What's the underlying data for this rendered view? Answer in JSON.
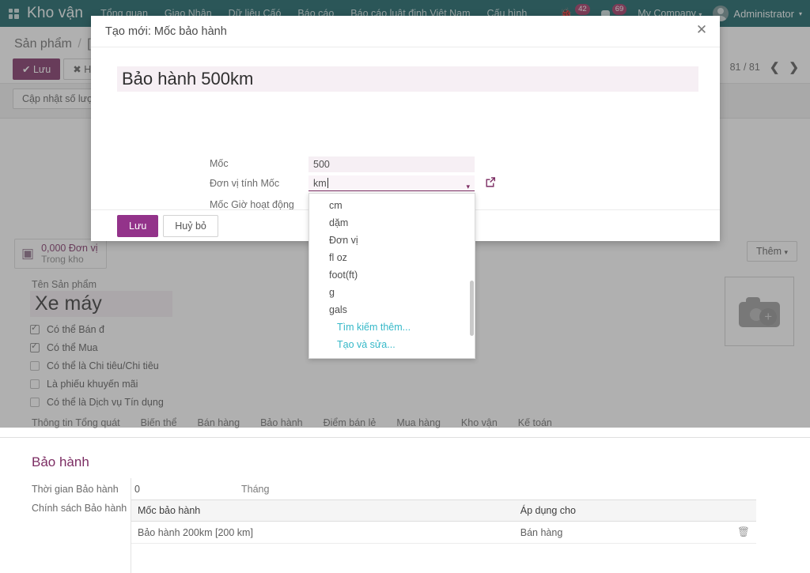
{
  "navbar": {
    "apps_icon": "apps-grid-icon",
    "brand": "Kho vận",
    "menu": [
      {
        "label": "Tổng quan"
      },
      {
        "label": "Giao Nhận"
      },
      {
        "label": "Dữ liệu Cấó"
      },
      {
        "label": "Báo cáo"
      },
      {
        "label": "Báo cáo luật định Việt Nam"
      },
      {
        "label": "Cấu hình"
      }
    ],
    "activity_icon": "bug-icon",
    "activity_count": "42",
    "messages_icon": "chat-icon",
    "messages_count": "69",
    "company": "My Company",
    "company_caret": "▾",
    "user": "Administrator",
    "user_caret": "▾"
  },
  "control_panel": {
    "breadcrumb_parent": "Sản phẩm",
    "breadcrumb_sep": "/",
    "breadcrumb_current": "[XM",
    "save_label": "Lưu",
    "save_icon": "check-icon",
    "discard_label": "Huỷ bỏ",
    "discard_icon": "times-icon",
    "update_qty_label": "Cập nhật số lượng",
    "pager_text": "81 / 81",
    "prev_icon": "chevron-left-icon",
    "next_icon": "chevron-right-icon",
    "add_dropdown_label": "Thêm",
    "add_dropdown_caret": "▾"
  },
  "stat_button": {
    "icon": "cubes-icon",
    "value": "0,000 Đơn vị",
    "label": "Trong kho"
  },
  "product_form": {
    "name_label": "Tên Sản phẩm",
    "name_value": "Xe máy",
    "image_placeholder_icon": "camera-add-icon",
    "checkboxes": [
      {
        "label": "Có thể Bán đ",
        "checked": true
      },
      {
        "label": "Có thể Mua ",
        "checked": true
      },
      {
        "label": "Có thể là Chi tiêu/Chi tiêu",
        "checked": false
      },
      {
        "label": "Là phiếu khuyến mãi",
        "checked": false
      },
      {
        "label": "Có thể là Dịch vụ Tín dụng",
        "checked": false
      }
    ]
  },
  "tabs": [
    {
      "label": "Thông tin Tổng quát",
      "active": true
    },
    {
      "label": "Biến thể",
      "active": false
    },
    {
      "label": "Bán hàng",
      "active": false
    },
    {
      "label": "Bảo hành",
      "active": false
    },
    {
      "label": "Điểm bán lẻ",
      "active": false
    },
    {
      "label": "Mua hàng",
      "active": false
    },
    {
      "label": "Kho vận",
      "active": false
    },
    {
      "label": "Kế toán",
      "active": false
    }
  ],
  "warranty": {
    "section_title": "Bảo hành",
    "duration_label": "Thời gian Bảo hành",
    "duration_value": "0",
    "duration_unit": "Tháng",
    "policy_label": "Chính sách Bảo hành",
    "table": {
      "headers": [
        "Mốc bảo hành",
        "Áp dụng cho",
        ""
      ],
      "rows": [
        {
          "milestone": "Bảo hành 200km [200 km]",
          "applies_to": "Bán hàng",
          "delete_icon": "trash-icon"
        }
      ]
    }
  },
  "modal": {
    "title": "Tạo mới: Mốc bảo hành",
    "close_icon": "close-icon",
    "record_title": "Bảo hành 500km",
    "fields": [
      {
        "label": "Mốc",
        "value": "500"
      },
      {
        "label": "Đơn vị tính Mốc",
        "value": "km"
      },
      {
        "label": "Mốc Giờ hoạt động",
        "value": ""
      }
    ],
    "external_link_icon": "external-link-icon",
    "dropdown_caret": "▾",
    "dropdown": {
      "options": [
        "cm",
        "dặm",
        "Đơn vị",
        "fl oz",
        "foot(ft)",
        "g",
        "gals"
      ],
      "actions": [
        "Tìm kiếm thêm...",
        "Tạo và sửa..."
      ]
    },
    "save_label": "Lưu",
    "cancel_label": "Huỷ bỏ"
  },
  "colors": {
    "navbar": "#0e5c60",
    "accent_purple": "#7c2d63",
    "modal_primary": "#93338a",
    "badge": "#9f2d5e",
    "link_cyan": "#35b8c8",
    "field_bg": "#f6eff4"
  }
}
